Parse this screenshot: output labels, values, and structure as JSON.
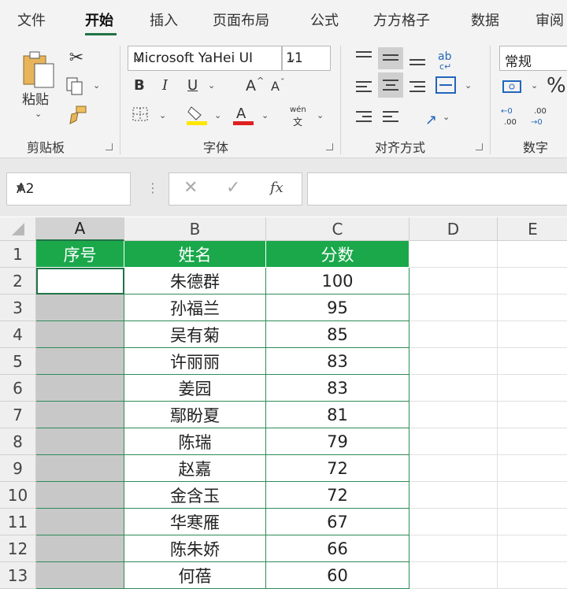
{
  "ribbon_tabs": [
    "文件",
    "开始",
    "插入",
    "页面布局",
    "公式",
    "方方格子",
    "数据",
    "审阅"
  ],
  "clipboard": {
    "paste_label": "粘贴",
    "group_label": "剪贴板"
  },
  "font": {
    "name": "Microsoft YaHei UI",
    "size": "11",
    "group_label": "字体",
    "bold": "B",
    "italic": "I",
    "underline": "U",
    "grow": "A",
    "shrink": "A",
    "phonetic_top": "wén",
    "phonetic_bottom": "文",
    "fill_color": "#ffe600",
    "font_color": "#e02020"
  },
  "alignment": {
    "group_label": "对齐方式"
  },
  "number": {
    "format": "常规",
    "group_label": "数字",
    "percent": "%"
  },
  "formula_bar": {
    "name_box": "A2",
    "fx": "fx",
    "content": ""
  },
  "columns": [
    "A",
    "B",
    "C",
    "D",
    "E"
  ],
  "table": {
    "headers": [
      "序号",
      "姓名",
      "分数"
    ],
    "rows": [
      {
        "row": "2",
        "name": "朱德群",
        "score": "100"
      },
      {
        "row": "3",
        "name": "孙福兰",
        "score": "95"
      },
      {
        "row": "4",
        "name": "吴有菊",
        "score": "85"
      },
      {
        "row": "5",
        "name": "许丽丽",
        "score": "83"
      },
      {
        "row": "6",
        "name": "姜园",
        "score": "83"
      },
      {
        "row": "7",
        "name": "鄢盼夏",
        "score": "81"
      },
      {
        "row": "8",
        "name": "陈瑞",
        "score": "79"
      },
      {
        "row": "9",
        "name": "赵嘉",
        "score": "72"
      },
      {
        "row": "10",
        "name": "金含玉",
        "score": "72"
      },
      {
        "row": "11",
        "name": "华寒雁",
        "score": "67"
      },
      {
        "row": "12",
        "name": "陈朱娇",
        "score": "66"
      },
      {
        "row": "13",
        "name": "何蓓",
        "score": "60"
      }
    ]
  },
  "colors": {
    "accent": "#217346",
    "header_fill": "#1aa84b",
    "selection_shade": "#c8c8c8"
  }
}
